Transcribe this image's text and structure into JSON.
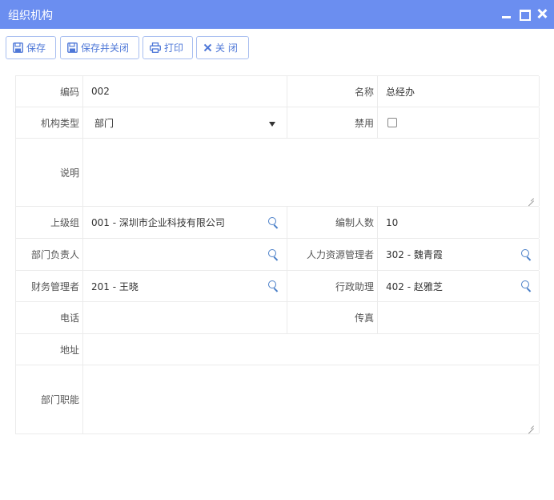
{
  "window": {
    "title": "组织机构",
    "controls": [
      "minimize-icon",
      "maximize-icon",
      "close-icon"
    ]
  },
  "toolbar": {
    "save": "保存",
    "save_close": "保存并关闭",
    "print": "打印",
    "close": "关 闭",
    "accent": "#4f78d8"
  },
  "form": {
    "code_label": "编码",
    "code_value": "002",
    "name_label": "名称",
    "name_value": "总经办",
    "type_label": "机构类型",
    "type_value": "部门",
    "disabled_label": "禁用",
    "disabled_checked": false,
    "desc_label": "说明",
    "desc_value": "",
    "parent_label": "上级组",
    "parent_value": "001 - 深圳市企业科技有限公司",
    "headcount_label": "编制人数",
    "headcount_value": "10",
    "dept_head_label": "部门负责人",
    "dept_head_value": "",
    "hr_label": "人力资源管理者",
    "hr_value": "302 - 魏青霞",
    "finance_label": "财务管理者",
    "finance_value": "201 - 王晓",
    "admin_label": "行政助理",
    "admin_value": "402 - 赵雅芝",
    "phone_label": "电话",
    "phone_value": "",
    "fax_label": "传真",
    "fax_value": "",
    "address_label": "地址",
    "address_value": "",
    "duty_label": "部门职能",
    "duty_value": ""
  },
  "colors": {
    "titlebar": "#6b8ef0",
    "icon": "#4a7fc8"
  }
}
